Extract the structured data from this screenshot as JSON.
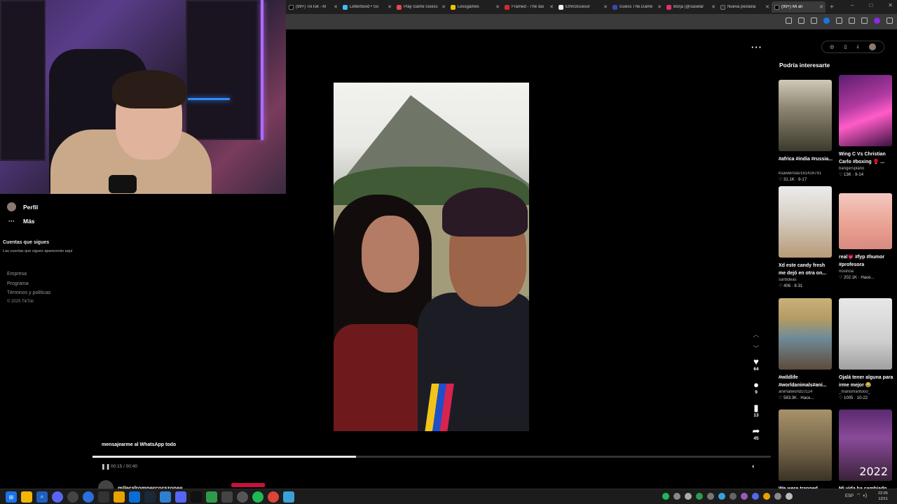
{
  "browser": {
    "tabs": [
      {
        "label": "(99+) TikTok - M",
        "color": "#000000"
      },
      {
        "label": "Letterboxd • So",
        "color": "#40bcf4"
      },
      {
        "label": "Play Game Guess",
        "color": "#e5484d"
      },
      {
        "label": "Lessgames",
        "color": "#e8c600"
      },
      {
        "label": "Framed - The dai",
        "color": "#d42a2a"
      },
      {
        "label": "EthnoGuessr",
        "color": "#f0f0f0"
      },
      {
        "label": "Guess The.Game",
        "color": "#3949ab"
      },
      {
        "label": "Borja (@saselar",
        "color": "#e1306c"
      },
      {
        "label": "Nueva pestaña",
        "color": "#2b2b2b"
      },
      {
        "label": "(99+) Mi an",
        "color": "#000000"
      }
    ],
    "new_tab": "+",
    "window_controls": [
      "–",
      "□",
      "✕"
    ]
  },
  "sidebar": {
    "profile_label": "Perfil",
    "more_label": "Más",
    "following_title": "Cuentas que sigues",
    "following_desc": "Las cuentas que sigues aparecerán aquí",
    "footer_links": [
      "Empresa",
      "Programa",
      "Términos y políticas"
    ],
    "copyright": "© 2025 TikTok"
  },
  "video": {
    "more_icon": "···",
    "caption": "mensajearme al WhatsApp todo",
    "current_time": "00:15",
    "duration": "00:40",
    "time_display": "00:15 / 00:40",
    "progress": 0.388,
    "author": "mileralrompercorazones",
    "actions": {
      "likes": "64",
      "comments": "9",
      "saves": "13",
      "shares": "45"
    }
  },
  "panel": {
    "title": "Podría interesarte",
    "items": [
      {
        "title": "#africa #india #russia...",
        "user": "ksawierslav161416741",
        "stats": "♡ 31.1K · 9-17"
      },
      {
        "title": "Wing C Vs Christian Carlo #boxing 🥊 ...",
        "user": "bangersplano",
        "stats": "♡ 13K · 9-14"
      },
      {
        "title": "Xd este candy fresh me dejó en otra on...",
        "user": "santideas",
        "stats": "♡ 406 · 8-31"
      },
      {
        "title": "real💗 #fyp #humor #profesora",
        "user": "nosinoa",
        "stats": "♡ 202.1K · Hace..."
      },
      {
        "title": "#wildlife #worldanimals#ani...",
        "user": "animalworld10114",
        "stats": "♡ 583.3K · Hace..."
      },
      {
        "title": "Ojalá tener alguna para irme mejor 😂",
        "user": "_mariomaritooo_",
        "stats": "♡ 1005 · 10-22"
      },
      {
        "title": "We were trapped...",
        "user": "",
        "stats": ""
      },
      {
        "title": "Mi vida ha cambiado...",
        "user": "",
        "stats": ""
      }
    ],
    "thumb_year": "2022"
  },
  "taskbar": {
    "language": "ESP",
    "time": "22:05",
    "date": "12/11"
  }
}
